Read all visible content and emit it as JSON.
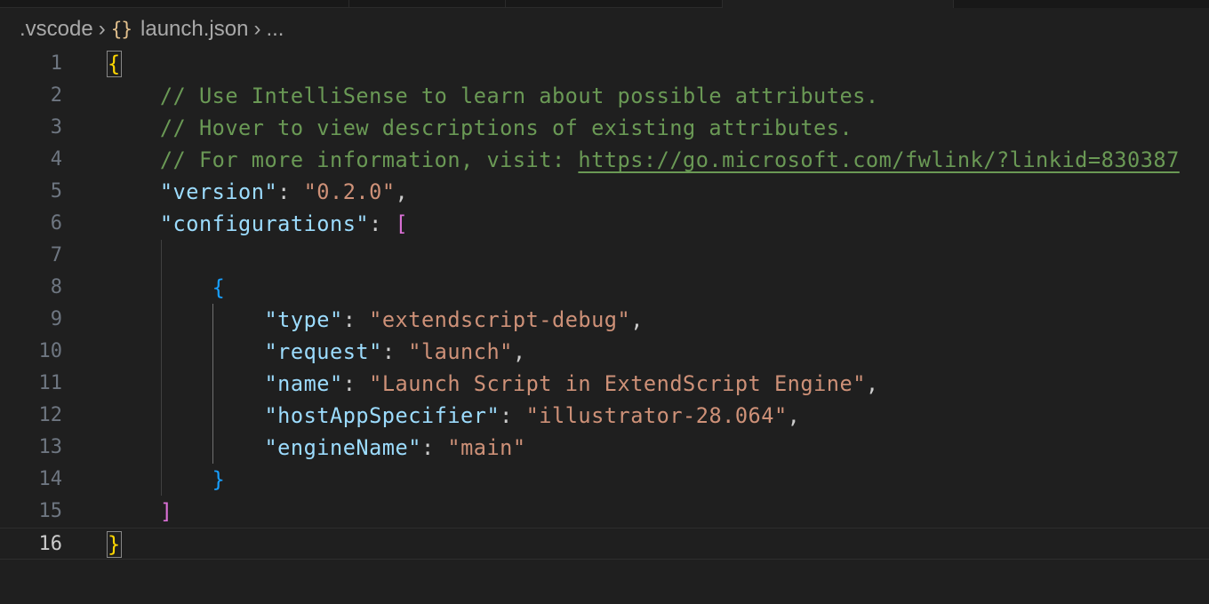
{
  "breadcrumb": {
    "folder": ".vscode",
    "file_icon": "{}",
    "file": "launch.json",
    "ellipsis": "..."
  },
  "editor": {
    "lines": [
      {
        "num": "1",
        "parts": {
          "open_brace": "{"
        }
      },
      {
        "num": "2",
        "parts": {
          "comment": "// Use IntelliSense to learn about possible attributes."
        }
      },
      {
        "num": "3",
        "parts": {
          "comment": "// Hover to view descriptions of existing attributes."
        }
      },
      {
        "num": "4",
        "parts": {
          "comment_prefix": "// For more information, visit: ",
          "link": "https://go.microsoft.com/fwlink/?linkid=830387"
        }
      },
      {
        "num": "5",
        "parts": {
          "key": "\"version\"",
          "sep": ": ",
          "value": "\"0.2.0\"",
          "end": ","
        }
      },
      {
        "num": "6",
        "parts": {
          "key": "\"configurations\"",
          "sep": ": ",
          "bracket": "["
        }
      },
      {
        "num": "7",
        "parts": {}
      },
      {
        "num": "8",
        "parts": {
          "brace": "{"
        }
      },
      {
        "num": "9",
        "parts": {
          "key": "\"type\"",
          "sep": ": ",
          "value": "\"extendscript-debug\"",
          "end": ","
        }
      },
      {
        "num": "10",
        "parts": {
          "key": "\"request\"",
          "sep": ": ",
          "value": "\"launch\"",
          "end": ","
        }
      },
      {
        "num": "11",
        "parts": {
          "key": "\"name\"",
          "sep": ": ",
          "value": "\"Launch Script in ExtendScript Engine\"",
          "end": ","
        }
      },
      {
        "num": "12",
        "parts": {
          "key": "\"hostAppSpecifier\"",
          "sep": ": ",
          "value": "\"illustrator-28.064\"",
          "end": ","
        }
      },
      {
        "num": "13",
        "parts": {
          "key": "\"engineName\"",
          "sep": ": ",
          "value": "\"main\""
        }
      },
      {
        "num": "14",
        "parts": {
          "brace": "}"
        }
      },
      {
        "num": "15",
        "parts": {
          "bracket": "]"
        }
      },
      {
        "num": "16",
        "parts": {
          "close_brace": "}"
        }
      }
    ],
    "current_line": "16"
  },
  "colors": {
    "background": "#1f1f1f",
    "comment": "#6a9955",
    "key": "#9cdcfe",
    "string": "#ce9178",
    "bracket_level1": "#ffd700",
    "bracket_level2": "#da70d6",
    "bracket_level3": "#179fff"
  }
}
